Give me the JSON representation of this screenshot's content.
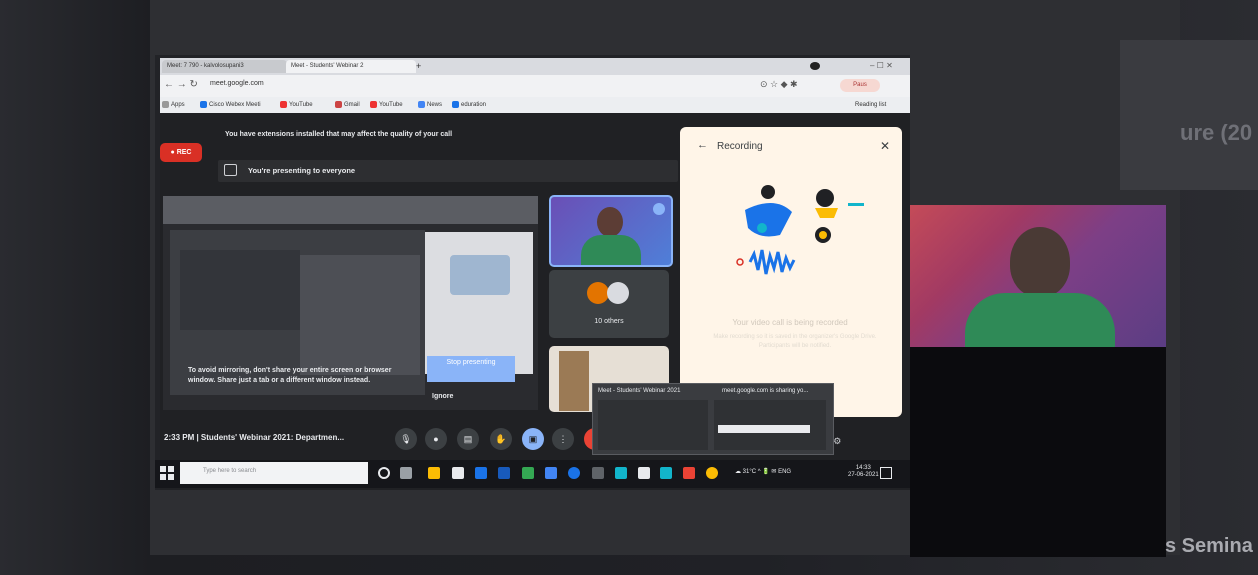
{
  "browser": {
    "tabs": [
      "Meet: 7 790 - kalvolosupani3",
      "Meet - Students' Webinar 2"
    ],
    "url": "meet.google.com",
    "bookmarks": [
      "Apps",
      "Cisco Webex Meeti",
      "YouTube",
      "Gmail",
      "YouTube",
      "News",
      "eduration"
    ],
    "reading_list": "Reading list",
    "profile_button": "Paus"
  },
  "meet": {
    "extension_warning": "You have extensions installed that may affect the quality of your call",
    "rec_badge": "REC",
    "presenting_notice": "You're presenting to everyone",
    "mirror_warning": "To avoid mirroring, don't share your entire screen or browser window. Share just a tab or a different window instead.",
    "stop_presenting": "Stop presenting",
    "ignore": "Ignore",
    "others_tile": "10 others",
    "clock_meeting": "2:33 PM  |  Students' Webinar 2021: Departmen..."
  },
  "recording_panel": {
    "title": "Recording",
    "message": "Your video call is being recorded",
    "sub": "Make recording so it is saved in the organizer's Google Drive. Participants will be notified."
  },
  "preview_popup": {
    "title_left": "Meet - Students' Webinar 2021",
    "title_right": "meet.google.com is sharing yo..."
  },
  "taskbar": {
    "search_placeholder": "Type here to search",
    "temp": "31°C",
    "lang": "ENG",
    "time": "14:33",
    "date": "27-06-2021"
  },
  "outer": {
    "title_fragment": "ure (20",
    "footer_fragment": "s Semina"
  },
  "colors": {
    "rec_red": "#d93025",
    "meet_bg": "#202124",
    "accent_blue": "#8ab4f8",
    "panel_bg": "#fff5e8"
  }
}
